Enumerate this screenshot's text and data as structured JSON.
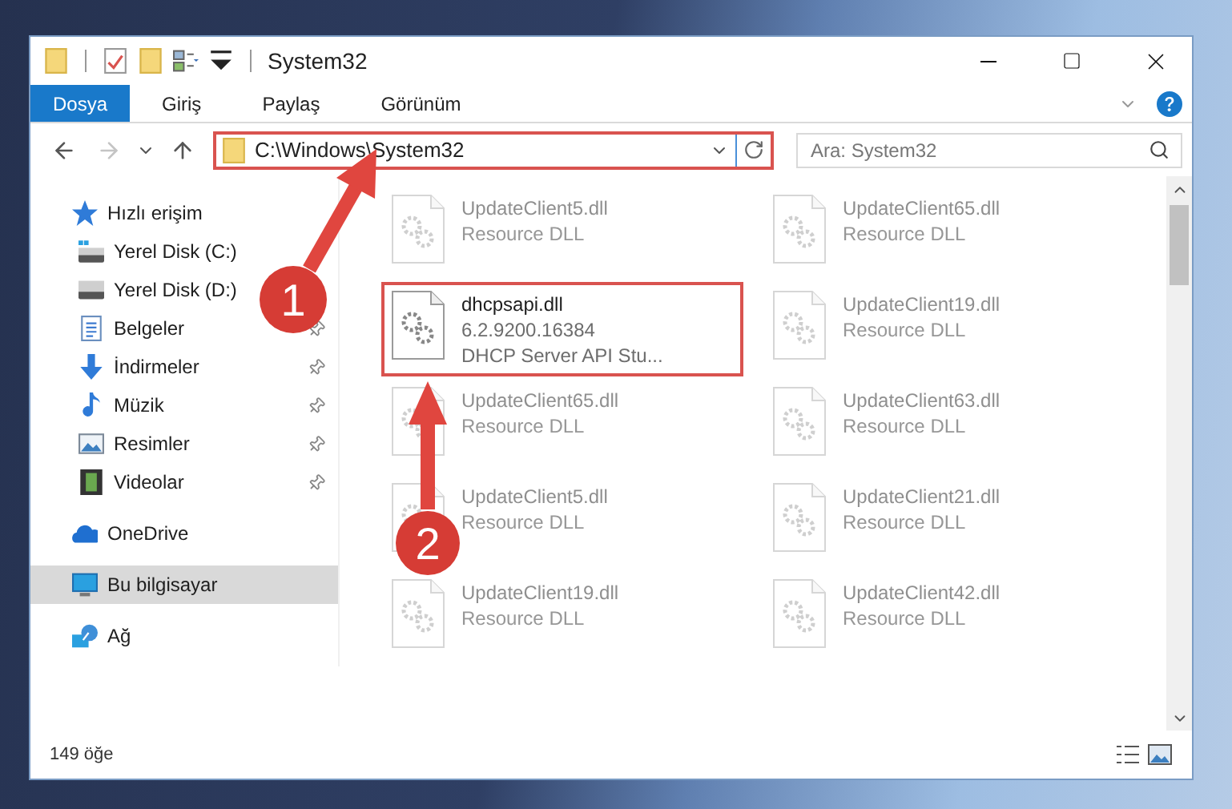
{
  "window": {
    "title": "System32"
  },
  "ribbon_tabs": [
    {
      "label": "Dosya",
      "kind": "file"
    },
    {
      "label": "Giriş",
      "kind": "tab"
    },
    {
      "label": "Paylaş",
      "kind": "tab"
    },
    {
      "label": "Görünüm",
      "kind": "tab"
    }
  ],
  "navigation": [
    {
      "kind": "back",
      "disabled": false
    },
    {
      "kind": "forward",
      "disabled": true
    },
    {
      "kind": "recent",
      "disabled": false
    },
    {
      "kind": "up",
      "disabled": false
    }
  ],
  "address_bar": {
    "path": "C:\\Windows\\System32",
    "highlighted": true
  },
  "search": {
    "placeholder": "Ara: System32"
  },
  "sidebar": {
    "items": [
      {
        "label": "Hızlı erişim",
        "kind": "star",
        "selected": false,
        "children": [
          {
            "label": "Yerel Disk (C:)",
            "kind": "drive-c",
            "pinned": false,
            "selected": false
          },
          {
            "label": "Yerel Disk (D:)",
            "kind": "drive",
            "pinned": false,
            "selected": false
          },
          {
            "label": "Belgeler",
            "kind": "documents",
            "pinned": true,
            "selected": false
          },
          {
            "label": "İndirmeler",
            "kind": "downloads",
            "pinned": true,
            "selected": false
          },
          {
            "label": "Müzik",
            "kind": "music",
            "pinned": true,
            "selected": false
          },
          {
            "label": "Resimler",
            "kind": "pictures",
            "pinned": true,
            "selected": false
          },
          {
            "label": "Videolar",
            "kind": "videos",
            "pinned": true,
            "selected": false
          }
        ]
      },
      {
        "label": "OneDrive",
        "kind": "cloud",
        "selected": false
      },
      {
        "label": "Bu bilgisayar",
        "kind": "computer",
        "selected": true
      },
      {
        "label": "Ağ",
        "kind": "network",
        "selected": false
      }
    ]
  },
  "files": [
    {
      "name": "UpdateClient5.dll",
      "details": [
        "Resource DLL"
      ],
      "highlighted": false,
      "blurred": true
    },
    {
      "name": "UpdateClient65.dll",
      "details": [
        "Resource DLL"
      ],
      "highlighted": false,
      "blurred": true
    },
    {
      "name": "dhcpsapi.dll",
      "details": [
        "6.2.9200.16384",
        "DHCP Server API Stu..."
      ],
      "highlighted": true,
      "blurred": false
    },
    {
      "name": "UpdateClient19.dll",
      "details": [
        "Resource DLL"
      ],
      "highlighted": false,
      "blurred": true
    },
    {
      "name": "UpdateClient65.dll",
      "details": [
        "Resource DLL"
      ],
      "highlighted": false,
      "blurred": true
    },
    {
      "name": "UpdateClient63.dll",
      "details": [
        "Resource DLL"
      ],
      "highlighted": false,
      "blurred": true
    },
    {
      "name": "UpdateClient5.dll",
      "details": [
        "Resource DLL"
      ],
      "highlighted": false,
      "blurred": true
    },
    {
      "name": "UpdateClient21.dll",
      "details": [
        "Resource DLL"
      ],
      "highlighted": false,
      "blurred": true
    },
    {
      "name": "UpdateClient19.dll",
      "details": [
        "Resource DLL"
      ],
      "highlighted": false,
      "blurred": true
    },
    {
      "name": "UpdateClient42.dll",
      "details": [
        "Resource DLL"
      ],
      "highlighted": false,
      "blurred": true
    }
  ],
  "status_bar": {
    "item_count": "149 öğe"
  },
  "annotations": [
    {
      "number": "1"
    },
    {
      "number": "2"
    }
  ]
}
